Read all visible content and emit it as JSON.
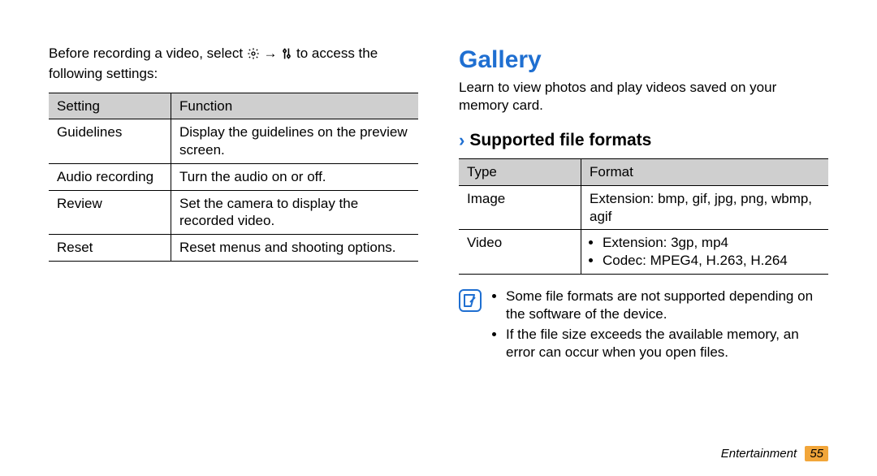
{
  "left": {
    "intro_pre": "Before recording a video, select ",
    "intro_mid": " → ",
    "intro_post": " to access the following settings:",
    "table": {
      "head": {
        "c0": "Setting",
        "c1": "Function"
      },
      "rows": [
        {
          "c0": "Guidelines",
          "c1": "Display the guidelines on the preview screen."
        },
        {
          "c0": "Audio recording",
          "c1": "Turn the audio on or off."
        },
        {
          "c0": "Review",
          "c1": "Set the camera to display the recorded video."
        },
        {
          "c0": "Reset",
          "c1": "Reset menus and shooting options."
        }
      ]
    }
  },
  "right": {
    "title": "Gallery",
    "intro": "Learn to view photos and play videos saved on your memory card.",
    "subhead": "Supported file formats",
    "table": {
      "head": {
        "c0": "Type",
        "c1": "Format"
      },
      "rows": [
        {
          "c0": "Image",
          "c1_text": "Extension: bmp, gif, jpg, png, wbmp, agif"
        },
        {
          "c0": "Video",
          "c1_b0": "Extension: 3gp, mp4",
          "c1_b1": "Codec: MPEG4, H.263, H.264"
        }
      ]
    },
    "notes": [
      "Some file formats are not supported depending on the software of the device.",
      "If the file size exceeds the available memory, an error can occur when you open files."
    ]
  },
  "footer": {
    "category": "Entertainment",
    "page": "55"
  },
  "chart_data": {
    "type": "table",
    "tables": [
      {
        "title": "Video recording settings",
        "columns": [
          "Setting",
          "Function"
        ],
        "rows": [
          [
            "Guidelines",
            "Display the guidelines on the preview screen."
          ],
          [
            "Audio recording",
            "Turn the audio on or off."
          ],
          [
            "Review",
            "Set the camera to display the recorded video."
          ],
          [
            "Reset",
            "Reset menus and shooting options."
          ]
        ]
      },
      {
        "title": "Gallery supported file formats",
        "columns": [
          "Type",
          "Format"
        ],
        "rows": [
          [
            "Image",
            "Extension: bmp, gif, jpg, png, wbmp, agif"
          ],
          [
            "Video",
            "Extension: 3gp, mp4; Codec: MPEG4, H.263, H.264"
          ]
        ]
      }
    ]
  }
}
